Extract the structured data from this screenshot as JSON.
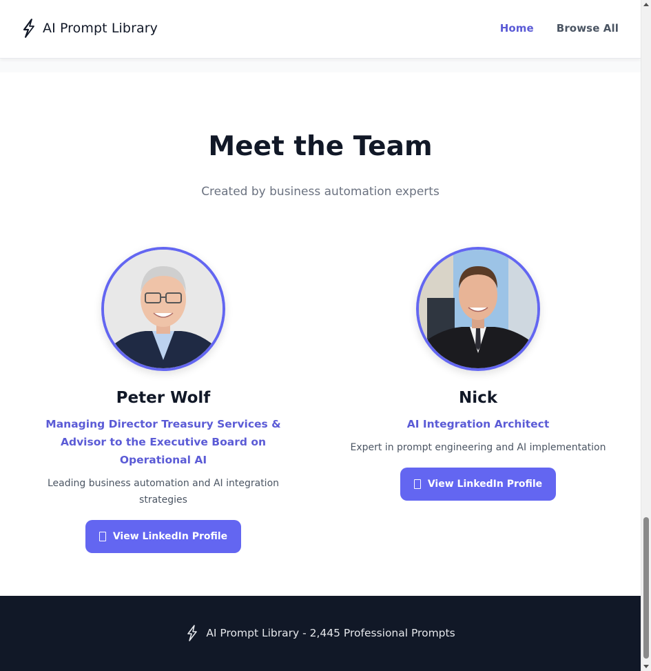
{
  "header": {
    "brand_text": "AI Prompt Library",
    "nav": [
      {
        "label": "Home",
        "active": true
      },
      {
        "label": "Browse All",
        "active": false
      }
    ]
  },
  "team": {
    "title": "Meet the Team",
    "subtitle": "Created by business automation experts",
    "members": [
      {
        "name": "Peter Wolf",
        "role": "Managing Director Treasury Services & Advisor to the Executive Board on Operational AI",
        "description": "Leading business automation and AI integration strategies",
        "button_label": "View LinkedIn Profile",
        "button_icon": "linkedin-icon"
      },
      {
        "name": "Nick",
        "role": "AI Integration Architect",
        "description": "Expert in prompt engineering and AI implementation",
        "button_label": "View LinkedIn Profile",
        "button_icon": "linkedin-icon"
      }
    ]
  },
  "footer": {
    "text": "AI Prompt Library - 2,445 Professional Prompts",
    "icon": "lightning-icon"
  },
  "colors": {
    "accent": "#6366f1",
    "accent_text": "#5b5bd6",
    "footer_bg": "#111827"
  }
}
